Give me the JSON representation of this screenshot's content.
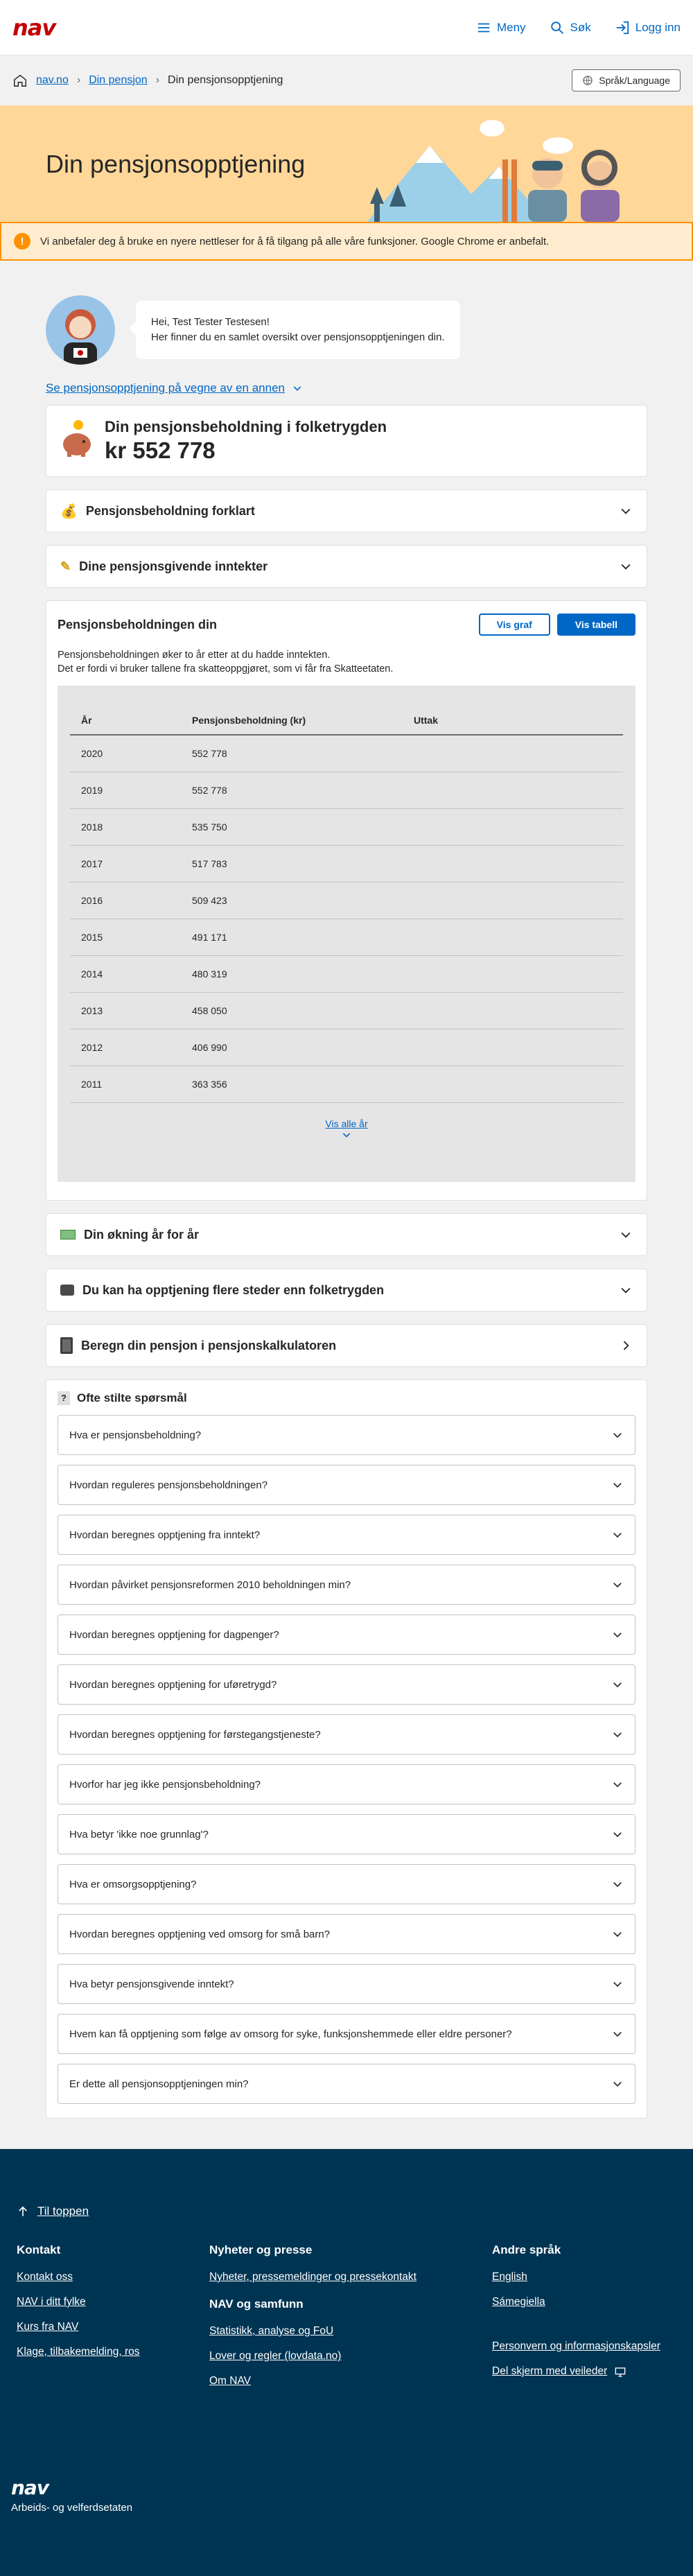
{
  "header": {
    "logo": "nav",
    "menu_label": "Meny",
    "search_label": "Søk",
    "login_label": "Logg inn"
  },
  "breadcrumb": {
    "items": [
      "nav.no",
      "Din pensjon",
      "Din pensjonsopptjening"
    ]
  },
  "language_button": "Språk/Language",
  "hero": {
    "title": "Din pensjonsopptjening"
  },
  "alert": {
    "text": "Vi anbefaler deg å bruke en nyere nettleser for å få tilgang på alle våre funksjoner. Google Chrome er anbefalt."
  },
  "greeting": {
    "line1": "Hei, Test Tester Testesen!",
    "line2": "Her finner du en samlet oversikt over pensjonsopptjeningen din."
  },
  "proxy_link": "Se pensjonsopptjening på vegne av en annen",
  "summary": {
    "title": "Din pensjonsbeholdning i folketrygden",
    "amount": "kr 552 778"
  },
  "accordions_top": [
    {
      "label": "Pensjonsbeholdning forklart",
      "icon": "money-bag-icon"
    },
    {
      "label": "Dine pensjonsgivende inntekter",
      "icon": "pen-icon"
    }
  ],
  "beholdning": {
    "title": "Pensjonsbeholdningen din",
    "btn_graph": "Vis graf",
    "btn_table": "Vis tabell",
    "desc1": "Pensjonsbeholdningen øker to år etter at du hadde inntekten.",
    "desc2": "Det er fordi vi bruker tallene fra skatteoppgjøret, som vi får fra Skatteetaten.",
    "columns": [
      "År",
      "Pensjonsbeholdning (kr)",
      "Uttak"
    ],
    "rows": [
      [
        "2020",
        "552 778",
        ""
      ],
      [
        "2019",
        "552 778",
        ""
      ],
      [
        "2018",
        "535 750",
        ""
      ],
      [
        "2017",
        "517 783",
        ""
      ],
      [
        "2016",
        "509 423",
        ""
      ],
      [
        "2015",
        "491 171",
        ""
      ],
      [
        "2014",
        "480 319",
        ""
      ],
      [
        "2013",
        "458 050",
        ""
      ],
      [
        "2012",
        "406 990",
        ""
      ],
      [
        "2011",
        "363 356",
        ""
      ]
    ],
    "show_all": "Vis alle år"
  },
  "accordions_bottom": [
    {
      "label": "Din økning år for år",
      "icon": "banknote-icon"
    },
    {
      "label": "Du kan ha opptjening flere steder enn folketrygden",
      "icon": "wallet-icon"
    },
    {
      "label": "Beregn din pensjon i pensjonskalkulatoren",
      "icon": "calculator-icon"
    }
  ],
  "faq": {
    "title": "Ofte stilte spørsmål",
    "questions": [
      "Hva er pensjonsbeholdning?",
      "Hvordan reguleres pensjonsbeholdningen?",
      "Hvordan beregnes opptjening fra inntekt?",
      "Hvordan påvirket pensjonsreformen 2010 beholdningen min?",
      "Hvordan beregnes opptjening for dagpenger?",
      "Hvordan beregnes opptjening for uføretrygd?",
      "Hvordan beregnes opptjening for førstegangstjeneste?",
      "Hvorfor har jeg ikke pensjonsbeholdning?",
      "Hva betyr 'ikke noe grunnlag'?",
      "Hva er omsorgsopptjening?",
      "Hvordan beregnes opptjening ved omsorg for små barn?",
      "Hva betyr pensjonsgivende inntekt?",
      "Hvem kan få opptjening som følge av omsorg for syke, funksjonshemmede eller eldre personer?",
      "Er dette all pensjonsopptjeningen min?"
    ]
  },
  "footer": {
    "to_top": "Til toppen",
    "col1": {
      "title": "Kontakt",
      "links": [
        "Kontakt oss",
        "NAV i ditt fylke",
        "Kurs fra NAV",
        "Klage, tilbakemelding, ros"
      ]
    },
    "col2": {
      "title": "Nyheter og presse",
      "links": [
        "Nyheter, pressemeldinger og pressekontakt"
      ]
    },
    "col2b": {
      "title": "NAV og samfunn",
      "links": [
        "Statistikk, analyse og FoU",
        "Lover og regler (lovdata.no)",
        "Om NAV"
      ]
    },
    "col3": {
      "title": "Andre språk",
      "links": [
        "English",
        "Sámegiella"
      ]
    },
    "col3b": {
      "links": [
        "Personvern og informasjonskapsler",
        "Del skjerm med veileder"
      ]
    },
    "logo": "nav",
    "org": "Arbeids- og velferdsetaten"
  }
}
